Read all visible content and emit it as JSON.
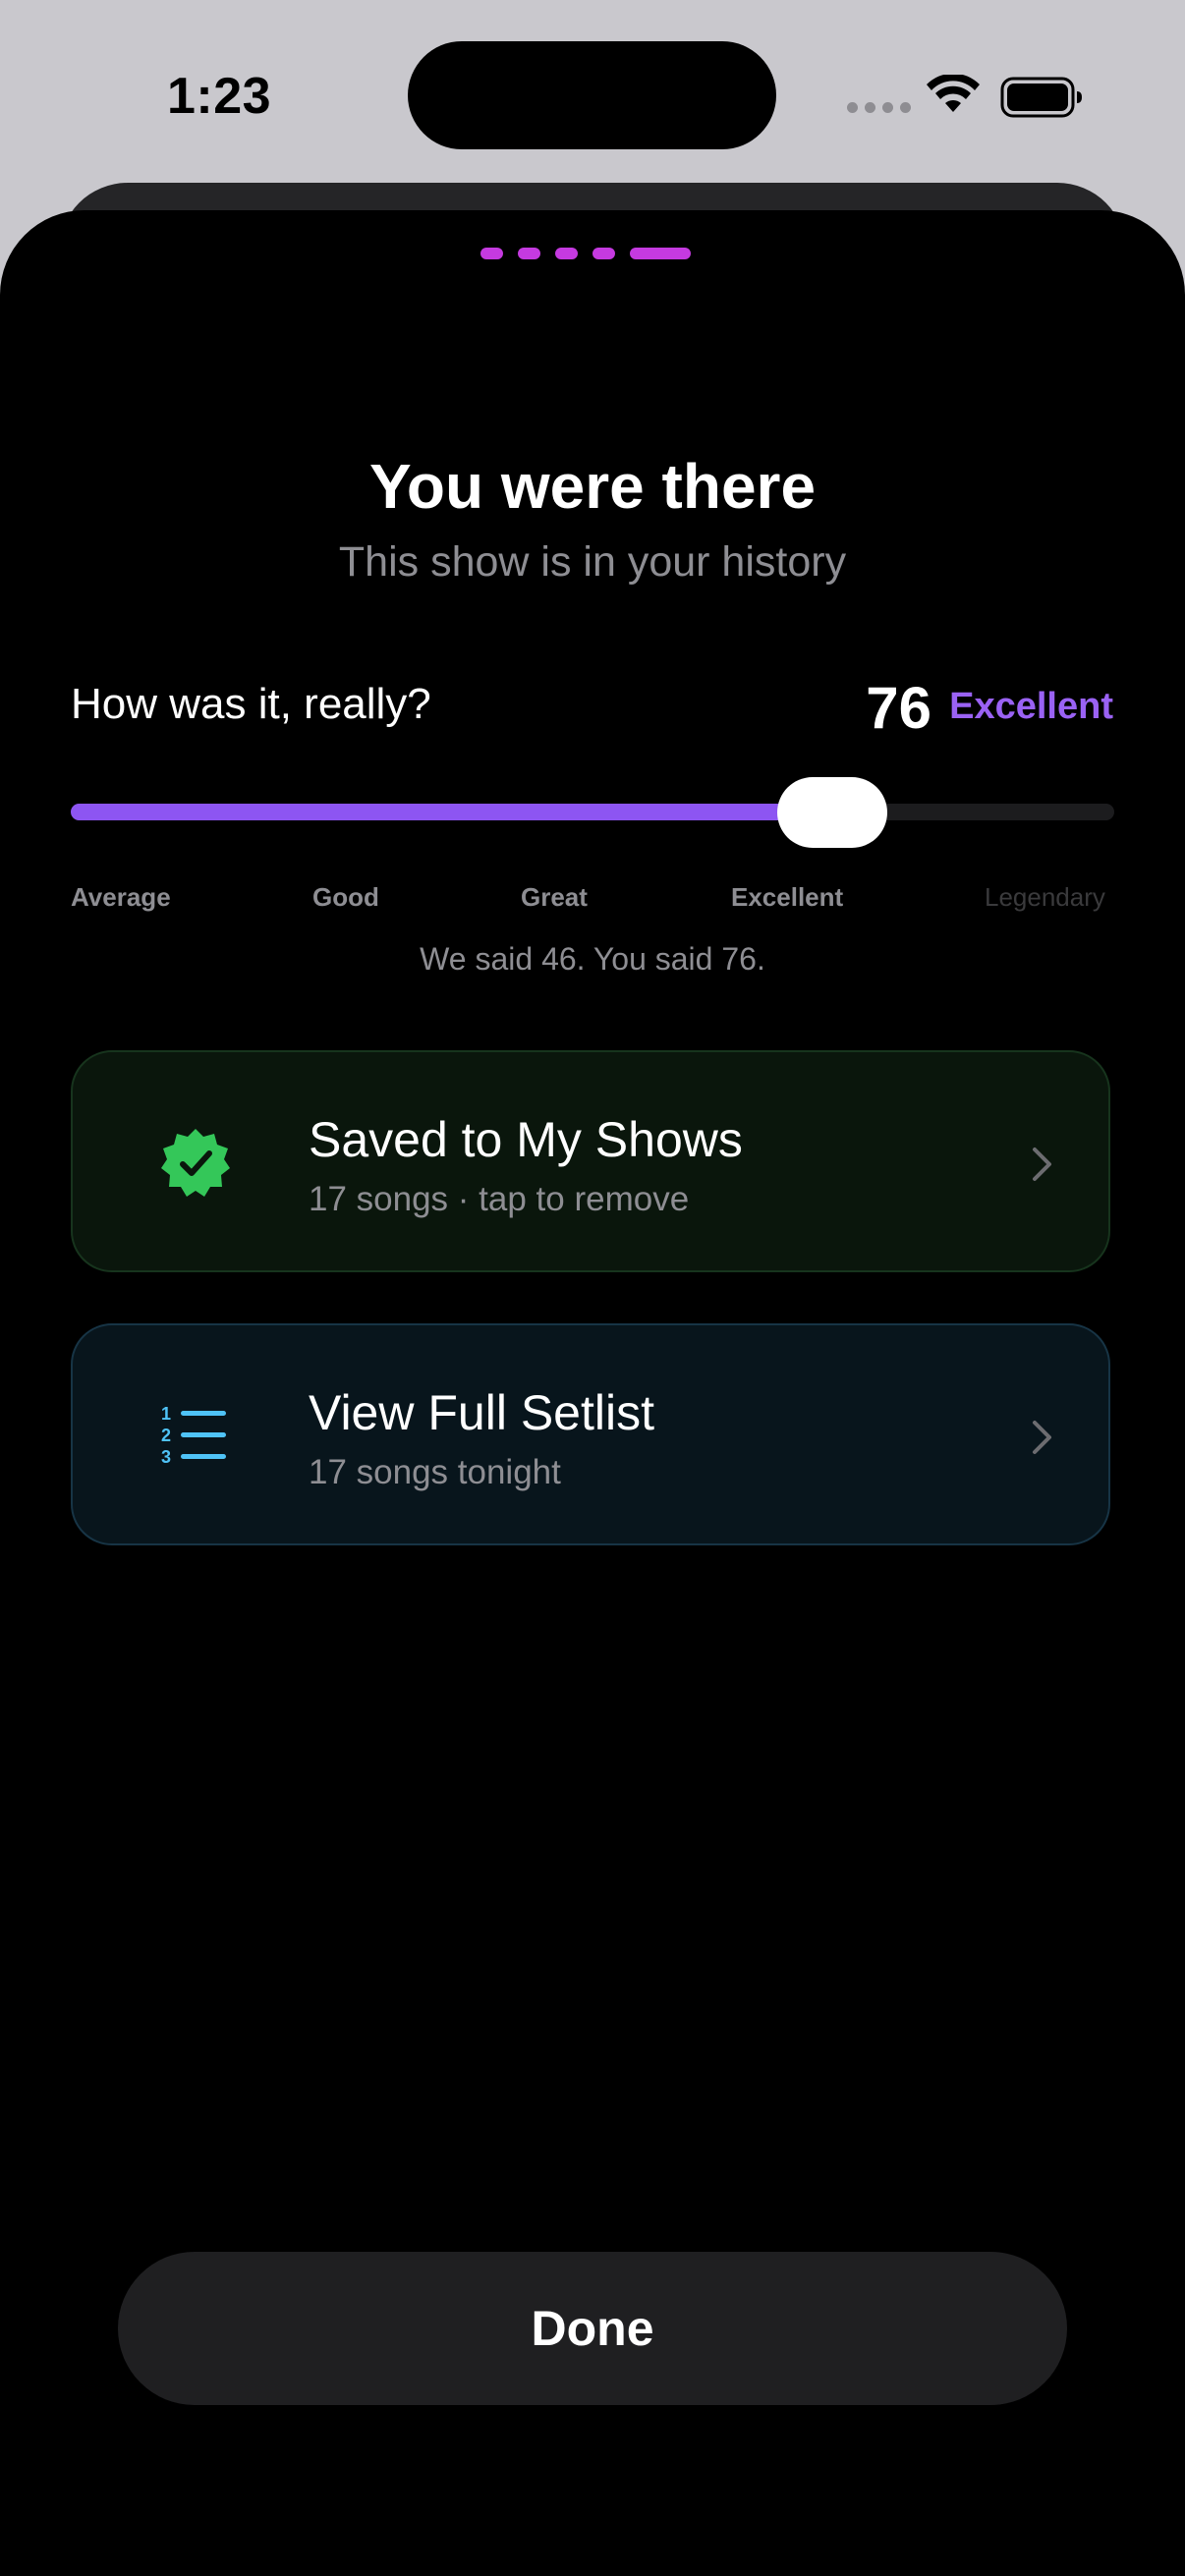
{
  "status_bar": {
    "time": "1:23"
  },
  "header": {
    "title": "You were there",
    "subtitle": "This show is in your history"
  },
  "rating": {
    "question": "How was it, really?",
    "score": "76",
    "score_label": "Excellent",
    "slider_fraction": 0.73,
    "ticks": [
      "Average",
      "Good",
      "Great",
      "Excellent",
      "Legendary"
    ],
    "comparison": "We said 46. You said 76."
  },
  "cards": {
    "saved": {
      "title": "Saved to My Shows",
      "subtitle": "17 songs · tap to remove",
      "icon": "verified-check-icon",
      "accent": "#34c759"
    },
    "setlist": {
      "title": "View Full Setlist",
      "subtitle": "17 songs tonight",
      "icon": "numbered-list-icon",
      "accent": "#4fc3f7"
    }
  },
  "done_label": "Done",
  "colors": {
    "accent_purple": "#8d55f2",
    "pager_magenta": "#c53ae0"
  }
}
